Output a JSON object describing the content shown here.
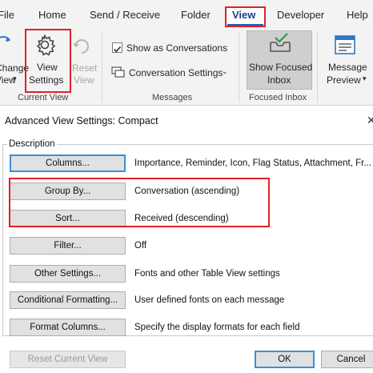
{
  "ribbon": {
    "tabs": {
      "file": "File",
      "home": "Home",
      "send_receive": "Send / Receive",
      "folder": "Folder",
      "view": "View",
      "developer": "Developer",
      "help": "Help"
    },
    "change_view": {
      "line1": "Change",
      "line2": "View"
    },
    "view_settings": {
      "line1": "View",
      "line2": "Settings"
    },
    "reset_view": {
      "line1": "Reset",
      "line2": "View"
    },
    "current_view_group": "Current View",
    "show_as_conversations": {
      "label": "Show as Conversations",
      "checked": true
    },
    "conversation_settings": "Conversation Settings",
    "messages_group": "Messages",
    "show_focused_inbox": {
      "line1": "Show Focused",
      "line2": "Inbox"
    },
    "focused_inbox_group": "Focused Inbox",
    "message_preview": {
      "line1": "Message",
      "line2": "Preview"
    }
  },
  "dialog": {
    "title": "Advanced View Settings: Compact",
    "description_legend": "Description",
    "rows": [
      {
        "button": "Columns...",
        "value": "Importance, Reminder, Icon, Flag Status, Attachment, Fr..."
      },
      {
        "button": "Group By...",
        "value": "Conversation (ascending)"
      },
      {
        "button": "Sort...",
        "value": "Received (descending)"
      },
      {
        "button": "Filter...",
        "value": "Off"
      },
      {
        "button": "Other Settings...",
        "value": "Fonts and other Table View settings"
      },
      {
        "button": "Conditional Formatting...",
        "value": "User defined fonts on each message"
      },
      {
        "button": "Format Columns...",
        "value": "Specify the display formats for each field"
      }
    ],
    "reset_button": "Reset Current View",
    "ok_button": "OK",
    "cancel_button": "Cancel"
  },
  "colors": {
    "highlight": "#e0202a",
    "accent": "#1f5fbf"
  }
}
